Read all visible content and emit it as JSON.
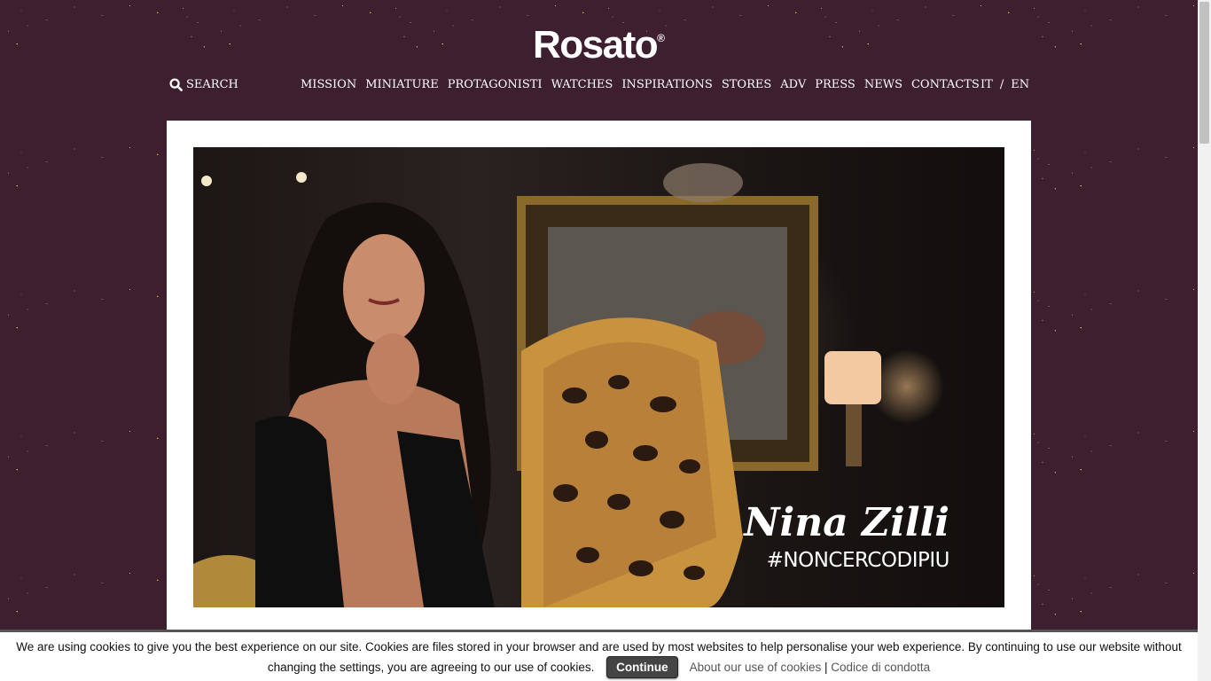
{
  "brand": {
    "logo_text": "Rosato",
    "logo_mark": "®"
  },
  "header": {
    "search_label": "SEARCH",
    "nav": [
      "MISSION",
      "MINIATURE",
      "PROTAGONISTI",
      "WATCHES",
      "INSPIRATIONS",
      "STORES",
      "ADV",
      "PRESS",
      "NEWS",
      "CONTACTS"
    ],
    "lang": {
      "it": "IT",
      "separator": "/",
      "en": "EN"
    }
  },
  "hero": {
    "title": "Nina Zilli",
    "tagline": "#NONCERCODIPIU"
  },
  "cookie": {
    "text": "We are using cookies to give you the best experience on our site. Cookies are files stored in your browser and are used by most websites to help personalise your web experience. By continuing to use our website without changing the settings, you are agreeing to our use of cookies.",
    "continue_label": "Continue",
    "about_link": "About our use of cookies",
    "separator": "|",
    "conduct_link": "Codice di condotta"
  },
  "colors": {
    "background": "#3e1f30",
    "sparkle": "#e8b84a",
    "panel": "#ffffff"
  }
}
